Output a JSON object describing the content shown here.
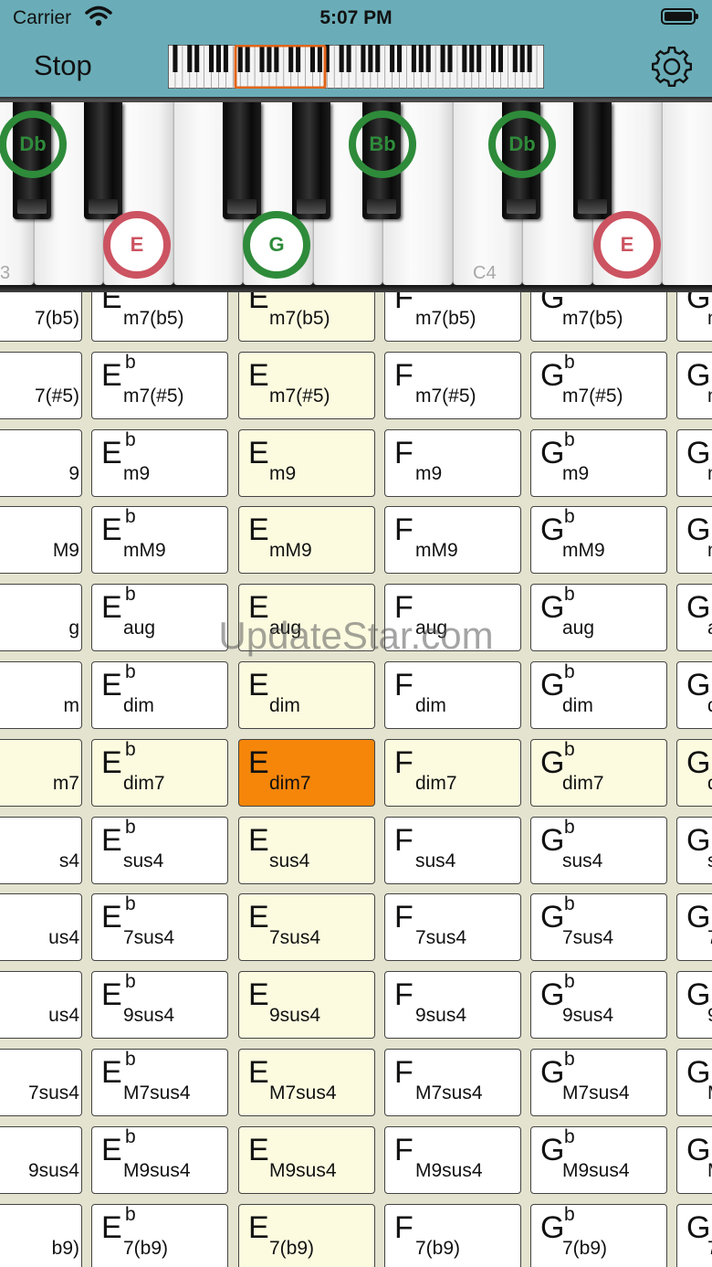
{
  "status_bar": {
    "carrier": "Carrier",
    "time": "5:07 PM"
  },
  "nav": {
    "stop_label": "Stop",
    "settings_icon": "gear-icon",
    "minimap_icon": "keyboard-overview"
  },
  "piano": {
    "key_labels": [
      "3",
      "C4"
    ],
    "notes": [
      {
        "label": "Db",
        "style": "green-ring"
      },
      {
        "label": "E",
        "style": "red-ring"
      },
      {
        "label": "G",
        "style": "green-fill"
      },
      {
        "label": "Bb",
        "style": "green-ring"
      },
      {
        "label": "Db",
        "style": "green-ring"
      },
      {
        "label": "E",
        "style": "red-ring"
      }
    ]
  },
  "chord_grid": {
    "columns": [
      {
        "root": "",
        "accidental": ""
      },
      {
        "root": "E",
        "accidental": "b"
      },
      {
        "root": "E",
        "accidental": ""
      },
      {
        "root": "F",
        "accidental": ""
      },
      {
        "root": "G",
        "accidental": "b"
      },
      {
        "root": "G",
        "accidental": ""
      }
    ],
    "rows": [
      {
        "left_fragment": "7(b5)",
        "suffix": "m7(b5)"
      },
      {
        "left_fragment": "7(#5)",
        "suffix": "m7(#5)"
      },
      {
        "left_fragment": "9",
        "suffix": "m9"
      },
      {
        "left_fragment": "M9",
        "suffix": "mM9"
      },
      {
        "left_fragment": "g",
        "suffix": "aug"
      },
      {
        "left_fragment": "m",
        "suffix": "dim"
      },
      {
        "left_fragment": "m7",
        "suffix": "dim7"
      },
      {
        "left_fragment": "s4",
        "suffix": "sus4"
      },
      {
        "left_fragment": "us4",
        "suffix": "7sus4"
      },
      {
        "left_fragment": "us4",
        "suffix": "9sus4"
      },
      {
        "left_fragment": "7sus4",
        "suffix": "M7sus4"
      },
      {
        "left_fragment": "9sus4",
        "suffix": "M9sus4"
      },
      {
        "left_fragment": "b9)",
        "suffix": "7(b9)"
      }
    ],
    "highlight_column": 2,
    "highlight_row": 6,
    "selected": {
      "column": 2,
      "row": 6
    }
  },
  "watermark": "UpdateStar.com",
  "colors": {
    "header": "#6aadb8",
    "selected": "#f5860a",
    "highlight": "#fcfbe0",
    "grid_bg": "#e4e3cf"
  }
}
